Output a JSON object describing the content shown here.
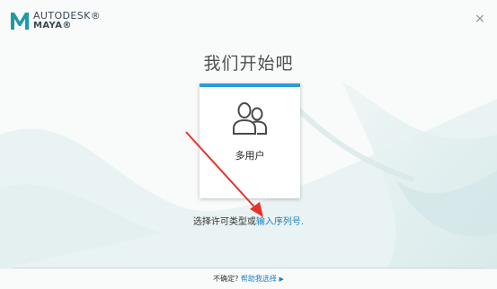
{
  "header": {
    "brand_line1": "AUTODESK®",
    "brand_line2": "MAYA®",
    "close_glyph": "×"
  },
  "main": {
    "title": "我们开始吧",
    "card": {
      "label": "多用户",
      "icon": "users-icon"
    },
    "choose_text": "选择许可类型或",
    "serial_link": "输入序列号",
    "serial_suffix": "."
  },
  "footer": {
    "prefix": "不确定?",
    "help_link": "帮助我选择",
    "arrow_glyph": "▶"
  },
  "colors": {
    "accent": "#2e9bd6",
    "link": "#1a7fc1",
    "annotation_arrow": "#e8322d",
    "logo": "#1f9aa5"
  }
}
